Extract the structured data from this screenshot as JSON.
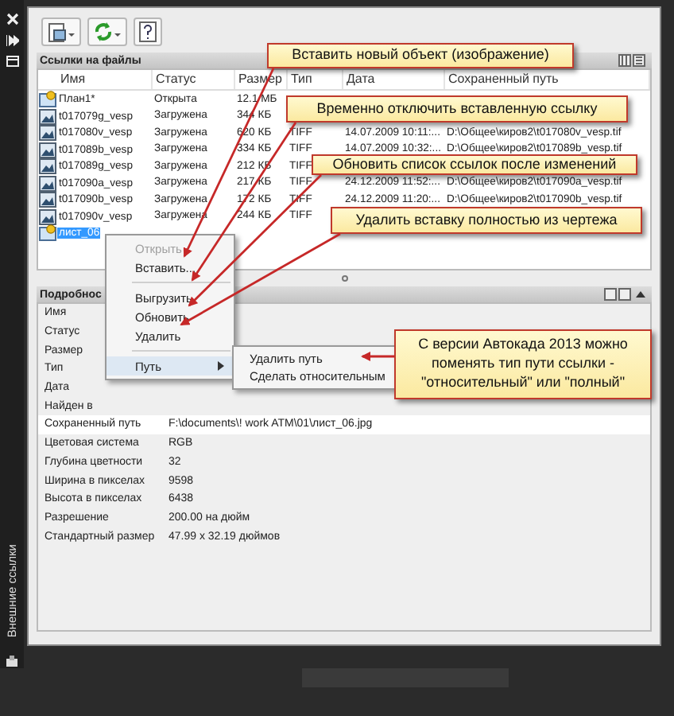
{
  "side_strip": {
    "label": "Внешние ссылки"
  },
  "file_refs": {
    "title": "Ссылки на файлы",
    "columns": [
      "Имя",
      "Статус",
      "Размер",
      "Тип",
      "Дата",
      "Сохраненный путь"
    ],
    "rows": [
      {
        "kind": "drawing",
        "name": "План1*",
        "status": "Открыта",
        "size": "12.1 МБ",
        "selected": false
      },
      {
        "kind": "image",
        "name": "t017079g_vesp",
        "status": "Загружена",
        "size": "344 КБ",
        "selected": false
      },
      {
        "kind": "image",
        "name": "t017080v_vesp",
        "status": "Загружена",
        "size": "620 КБ",
        "type": "TIFF",
        "date": "14.07.2009 10:11:...",
        "path": "D:\\Общее\\киров2\\t017080v_vesp.tif",
        "selected": false
      },
      {
        "kind": "image",
        "name": "t017089b_vesp",
        "status": "Загружена",
        "size": "334 КБ",
        "type": "TIFF",
        "date": "14.07.2009 10:32:...",
        "path": "D:\\Общее\\киров2\\t017089b_vesp.tif",
        "selected": false
      },
      {
        "kind": "image",
        "name": "t017089g_vesp",
        "status": "Загружена",
        "size": "212 КБ",
        "type": "TIFF",
        "selected": false
      },
      {
        "kind": "image",
        "name": "t017090a_vesp",
        "status": "Загружена",
        "size": "217 КБ",
        "type": "TIFF",
        "date": "24.12.2009 11:52:...",
        "path": "D:\\Общее\\киров2\\t017090a_vesp.tif",
        "selected": false
      },
      {
        "kind": "image",
        "name": "t017090b_vesp",
        "status": "Загружена",
        "size": "172 КБ",
        "type": "TIFF",
        "date": "24.12.2009 11:20:...",
        "path": "D:\\Общее\\киров2\\t017090b_vesp.tif",
        "selected": false
      },
      {
        "kind": "image",
        "name": "t017090v_vesp",
        "status": "Загружена",
        "size": "244 КБ",
        "type": "TIFF",
        "selected": false
      },
      {
        "kind": "drawing",
        "name": "лист_06",
        "selected": true
      }
    ]
  },
  "details": {
    "title": "Подробнос",
    "fields": [
      {
        "label": "Имя",
        "highlighted": false
      },
      {
        "label": "Статус",
        "highlighted": false
      },
      {
        "label": "Размер",
        "highlighted": false
      },
      {
        "label": "Тип",
        "highlighted": false
      },
      {
        "label": "Дата",
        "highlighted": false
      },
      {
        "label": "Найден в",
        "highlighted": false
      },
      {
        "label": "Сохраненный путь",
        "value": "F:\\documents\\! work ATM\\01\\лист_06.jpg",
        "highlighted": true
      },
      {
        "label": "Цветовая система",
        "value": "RGB",
        "highlighted": false
      },
      {
        "label": "Глубина цветности",
        "value": "32",
        "highlighted": false
      },
      {
        "label": "Ширина в пикселах",
        "value": "9598",
        "highlighted": false
      },
      {
        "label": "Высота в пикселах",
        "value": "6438",
        "highlighted": false
      },
      {
        "label": "Разрешение",
        "value": "200.00 на дюйм",
        "highlighted": false
      },
      {
        "label": "Стандартный размер",
        "value": "47.99 x 32.19 дюймов",
        "highlighted": false
      }
    ]
  },
  "context_menu": {
    "items": [
      {
        "kind": "item",
        "label": "Открыть",
        "disabled": true
      },
      {
        "kind": "item",
        "label": "Вставить...",
        "disabled": false
      },
      {
        "kind": "separator"
      },
      {
        "kind": "item",
        "label": "Выгрузить",
        "disabled": false
      },
      {
        "kind": "item",
        "label": "Обновить",
        "disabled": false
      },
      {
        "kind": "item",
        "label": "Удалить",
        "disabled": false
      },
      {
        "kind": "separator"
      },
      {
        "kind": "submenu",
        "label": "Путь",
        "disabled": false,
        "expanded": true
      }
    ],
    "submenu": [
      "Удалить путь",
      "Сделать относительным"
    ]
  },
  "callouts": [
    "Вставить новый объект (изображение)",
    "Временно отключить вставленную ссылку",
    "Обновить список ссылок после изменений",
    "Удалить вставку полностью из чертежа",
    "С версии Автокада 2013 можно поменять тип пути ссылки - \"относительный\" или \"полный\""
  ]
}
